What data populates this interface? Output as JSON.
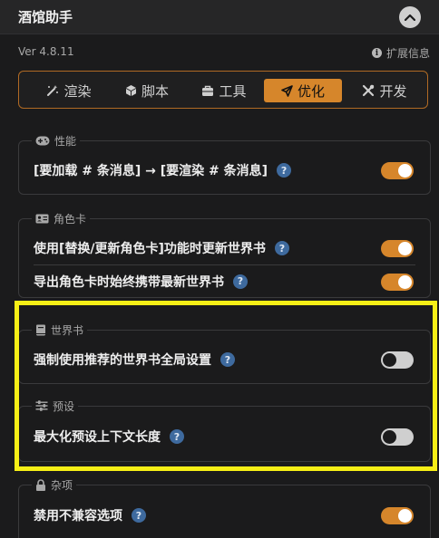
{
  "header": {
    "title": "酒馆助手",
    "collapse_icon": "chevron-up-icon"
  },
  "version": "Ver 4.8.11",
  "extension_info": {
    "label": "扩展信息",
    "icon": "info-icon"
  },
  "tabs": [
    {
      "label": "渲染",
      "icon": "magic-wand-icon",
      "active": false
    },
    {
      "label": "脚本",
      "icon": "cube-icon",
      "active": false
    },
    {
      "label": "工具",
      "icon": "toolbox-icon",
      "active": false
    },
    {
      "label": "优化",
      "icon": "send-icon",
      "active": true
    },
    {
      "label": "开发",
      "icon": "tools-icon",
      "active": false
    }
  ],
  "sections": [
    {
      "title": "性能",
      "icon": "gamepad-icon",
      "rows": [
        {
          "label": "[要加载 # 条消息] → [要渲染 # 条消息]",
          "help": "?",
          "enabled": true
        }
      ]
    },
    {
      "title": "角色卡",
      "icon": "id-card-icon",
      "rows": [
        {
          "label": "使用[替换/更新角色卡]功能时更新世界书",
          "help": "?",
          "enabled": true
        },
        {
          "label": "导出角色卡时始终携带最新世界书",
          "help": "?",
          "enabled": true
        }
      ]
    },
    {
      "title": "世界书",
      "icon": "book-icon",
      "rows": [
        {
          "label": "强制使用推荐的世界书全局设置",
          "help": "?",
          "enabled": false
        }
      ]
    },
    {
      "title": "预设",
      "icon": "sliders-icon",
      "rows": [
        {
          "label": "最大化预设上下文长度",
          "help": "?",
          "enabled": false
        }
      ]
    },
    {
      "title": "杂项",
      "icon": "lock-icon",
      "rows": [
        {
          "label": "禁用不兼容选项",
          "help": "?",
          "enabled": true
        }
      ]
    }
  ],
  "colors": {
    "accent": "#d6862b",
    "highlight": "#f7ef16",
    "help_badge": "#3e6a9e",
    "background": "#1b1b1c"
  }
}
